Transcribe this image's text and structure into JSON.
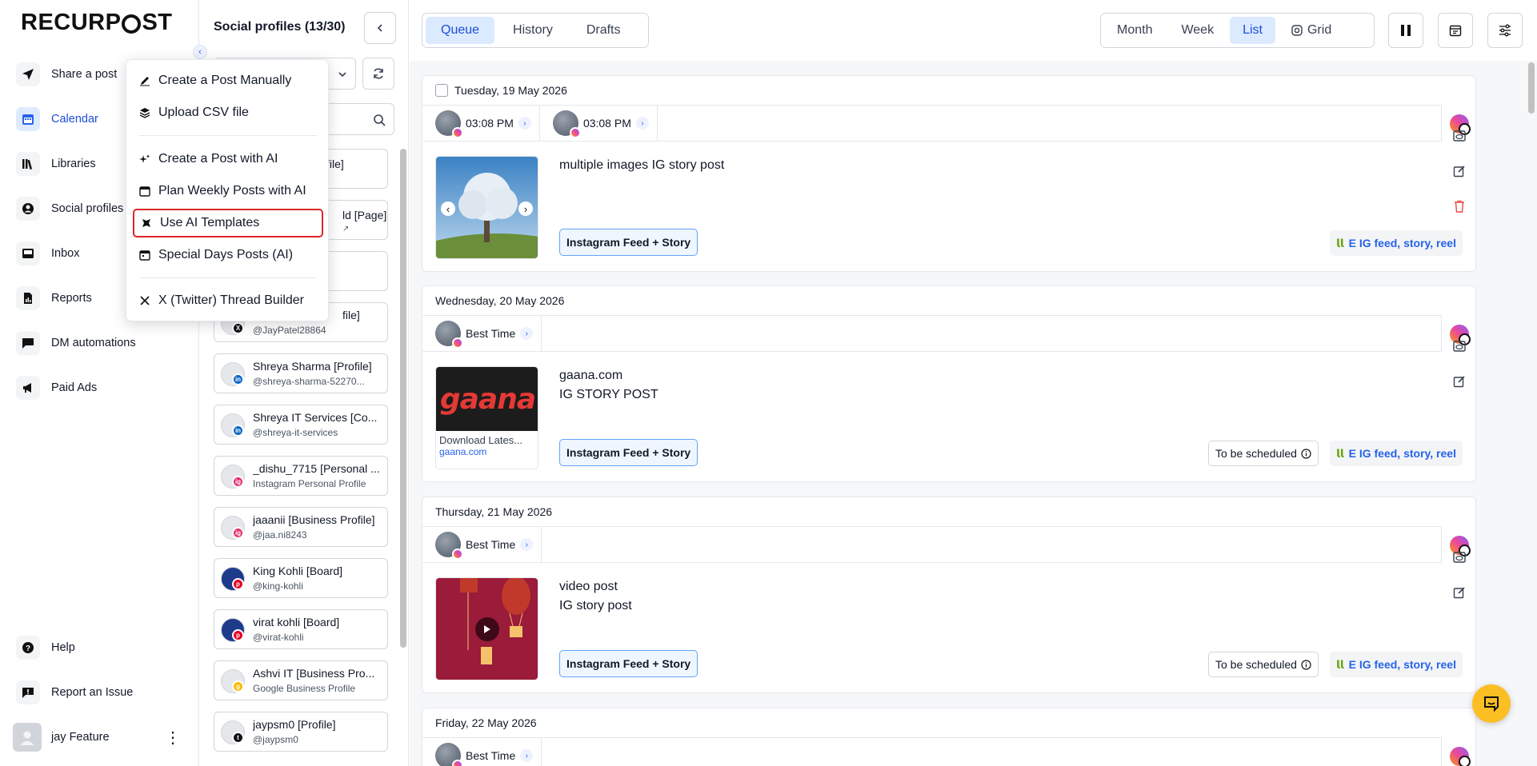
{
  "brand": {
    "logo_prefix": "RECURP",
    "logo_suffix": "ST"
  },
  "nav": {
    "items": [
      {
        "label": "Share a post",
        "icon": "send-icon"
      },
      {
        "label": "Calendar",
        "icon": "calendar-icon"
      },
      {
        "label": "Libraries",
        "icon": "library-icon"
      },
      {
        "label": "Social profiles",
        "icon": "user-circle-icon"
      },
      {
        "label": "Inbox",
        "icon": "inbox-icon"
      },
      {
        "label": "Reports",
        "icon": "report-icon"
      },
      {
        "label": "DM automations",
        "icon": "chat-icon"
      },
      {
        "label": "Paid Ads",
        "icon": "megaphone-icon"
      }
    ],
    "help": "Help",
    "report_issue": "Report an Issue",
    "user_name": "jay Feature"
  },
  "menu": {
    "items": [
      {
        "label": "Create a Post Manually",
        "icon": "pen-icon"
      },
      {
        "label": "Upload CSV file",
        "icon": "layers-icon"
      },
      {
        "label": "Create a Post with AI",
        "icon": "sparkle-icon"
      },
      {
        "label": "Plan Weekly Posts with AI",
        "icon": "calendar-icon"
      },
      {
        "label": "Use AI Templates",
        "icon": "magic-icon"
      },
      {
        "label": "Special Days Posts (AI)",
        "icon": "calendar-icon"
      },
      {
        "label": "X (Twitter) Thread Builder",
        "icon": "x-logo-icon"
      }
    ]
  },
  "profiles": {
    "title": "Social profiles (13/30)",
    "partial": [
      "file]",
      "ld [Page]",
      "file]"
    ],
    "cards": [
      {
        "name": "Shreya Sharma [Profile]",
        "handle": "@shreya-sharma-52270...",
        "net": "in",
        "color": "#0a66c2"
      },
      {
        "name": "Shreya IT Services [Co...",
        "handle": "@shreya-it-services",
        "net": "in",
        "color": "#0a66c2"
      },
      {
        "name": "_dishu_7715 [Personal ...",
        "handle": "Instagram Personal Profile",
        "net": "ig",
        "color": "#e1306c"
      },
      {
        "name": "jaaanii [Business Profile]",
        "handle": "@jaa.ni8243",
        "net": "ig",
        "color": "#e1306c"
      },
      {
        "name": "King Kohli [Board]",
        "handle": "@king-kohli",
        "net": "p",
        "color": "#e60023"
      },
      {
        "name": "virat kohli [Board]",
        "handle": "@virat-kohli",
        "net": "p",
        "color": "#e60023"
      },
      {
        "name": "Ashvi IT [Business Pro...",
        "handle": "Google Business Profile",
        "net": "g",
        "color": "#fbbc04"
      },
      {
        "name": "jaypsm0 [Profile]",
        "handle": "@jaypsm0",
        "net": "t",
        "color": "#111111"
      }
    ],
    "twitter_handle": "@JayPatel28864"
  },
  "tabs": [
    "Queue",
    "History",
    "Drafts"
  ],
  "views": [
    "Month",
    "Week",
    "List",
    "Grid"
  ],
  "days": [
    {
      "date": "Tuesday, 19 May 2026",
      "times": [
        "03:08 PM",
        "03:08 PM"
      ],
      "text_lines": [
        "multiple images IG story post"
      ],
      "post_type": "Instagram Feed + Story",
      "library": "E IG feed, story, reel"
    },
    {
      "date": "Wednesday, 20 May 2026",
      "times": [
        "Best Time"
      ],
      "text_lines": [
        "gaana.com",
        "IG STORY POST"
      ],
      "post_type": "Instagram Feed + Story",
      "status": "To be scheduled",
      "library": "E IG feed, story, reel",
      "link_title": "Download Lates...",
      "link_domain": "gaana.com",
      "thumb_text": "gaana"
    },
    {
      "date": "Thursday, 21 May 2026",
      "times": [
        "Best Time"
      ],
      "text_lines": [
        "video post",
        "IG story post"
      ],
      "post_type": "Instagram Feed + Story",
      "status": "To be scheduled",
      "library": "E IG feed, story, reel"
    },
    {
      "date": "Friday, 22 May 2026",
      "times": [
        "Best Time"
      ]
    }
  ],
  "colors": {
    "accent": "#2563eb",
    "highlight": "#dc2626",
    "tab_active_bg": "#dbeafe"
  }
}
